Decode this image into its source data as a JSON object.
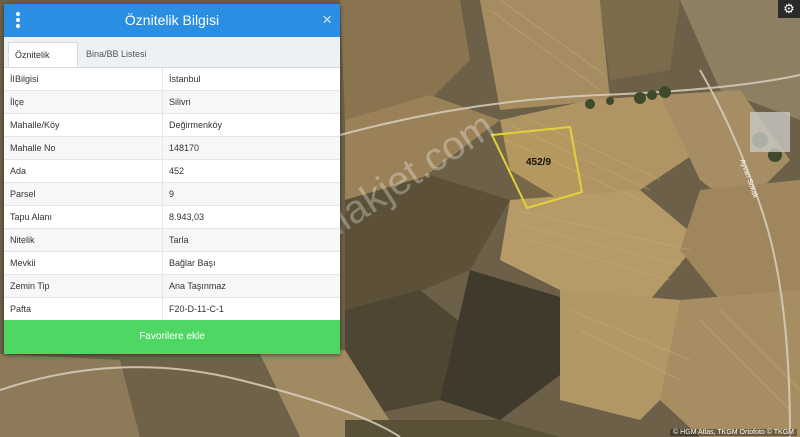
{
  "panel": {
    "title": "Öznitelik Bilgisi",
    "close_glyph": "×",
    "tabs": [
      {
        "label": "Öznitelik Bilgisi",
        "active": true
      },
      {
        "label": "Bina/BB Listesi",
        "active": false
      }
    ],
    "rows": [
      {
        "key": "İl",
        "value": "İstanbul"
      },
      {
        "key": "İlçe",
        "value": "Silivri"
      },
      {
        "key": "Mahalle/Köy",
        "value": "Değirmenköy"
      },
      {
        "key": "Mahalle No",
        "value": "148170"
      },
      {
        "key": "Ada",
        "value": "452"
      },
      {
        "key": "Parsel",
        "value": "9"
      },
      {
        "key": "Tapu Alanı",
        "value": "8.943,03"
      },
      {
        "key": "Nitelik",
        "value": "Tarla"
      },
      {
        "key": "Mevkii",
        "value": "Bağlar Başı"
      },
      {
        "key": "Zemin Tip",
        "value": "Ana Taşınmaz"
      },
      {
        "key": "Pafta",
        "value": "F20-D-11-C-1"
      }
    ],
    "favorite_button": "Favorilere ekle"
  },
  "map": {
    "parcel_label": "452/9",
    "watermark": "emlakjet.com",
    "attribution": "© HGM Atlas, TKGM Ortofoto © TKGM",
    "road_label": "Ayvan Sokak",
    "gear_glyph": "⚙"
  },
  "colors": {
    "header": "#2a8ee3",
    "favorite_button": "#4fd764",
    "parcel_outline": "#e2d23a"
  }
}
